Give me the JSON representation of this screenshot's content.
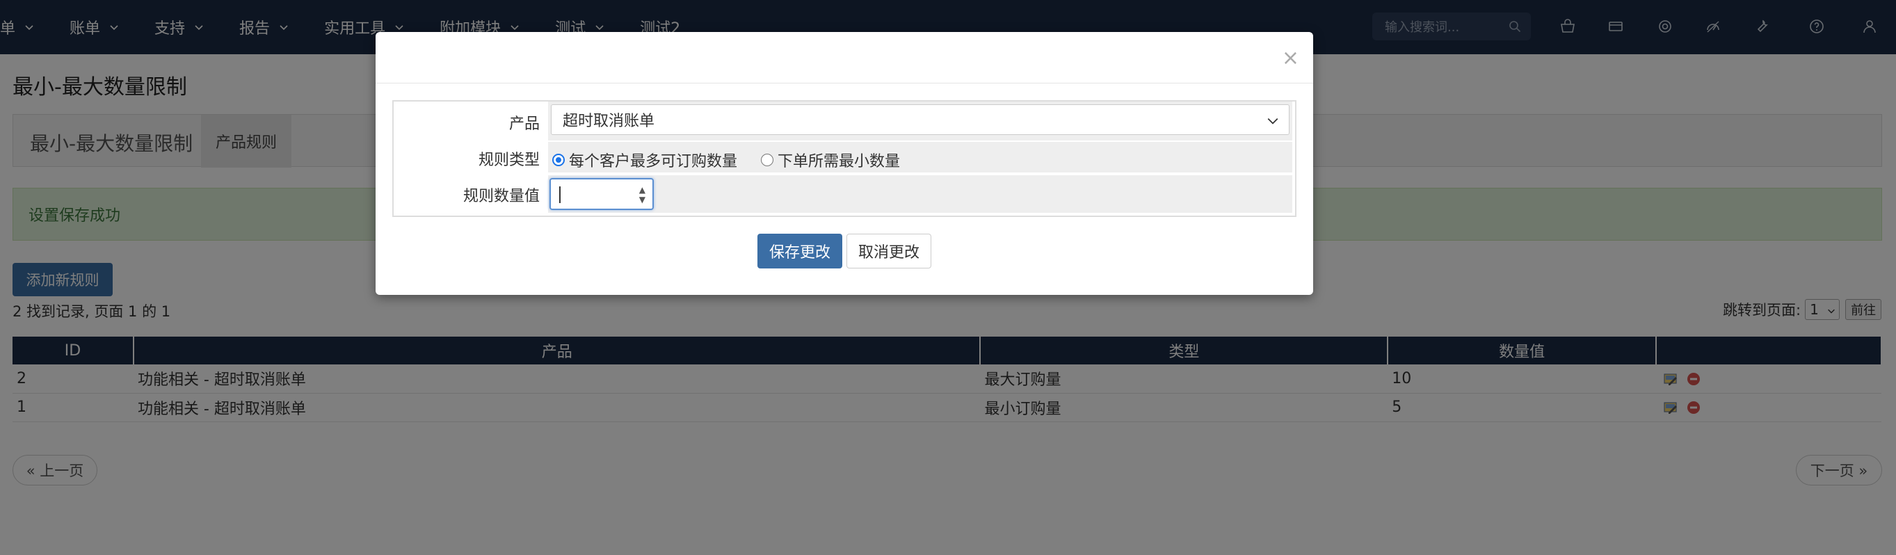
{
  "nav": {
    "items": [
      "单",
      "账单",
      "支持",
      "报告",
      "实用工具",
      "附加模块",
      "测试",
      "测试2"
    ],
    "search_placeholder": "输入搜索词...",
    "icons": [
      "cart-icon",
      "ticket-icon",
      "support-icon",
      "gauge-icon",
      "wrench-icon",
      "help-icon",
      "user-icon"
    ]
  },
  "page": {
    "title": "最小-最大数量限制",
    "tab_main": "最小-最大数量限制",
    "tab_active": "产品规则",
    "alert": "设置保存成功",
    "add_button": "添加新规则",
    "records": "2 找到记录, 页面 1 的 1",
    "jump_label": "跳转到页面:",
    "jump_value": "1",
    "jump_go": "前往",
    "prev": "« 上一页",
    "next": "下一页 »"
  },
  "table": {
    "headers": [
      "ID",
      "产品",
      "类型",
      "数量值",
      ""
    ],
    "rows": [
      {
        "id": "2",
        "product": "功能相关 - 超时取消账单",
        "type": "最大订购量",
        "value": "10"
      },
      {
        "id": "1",
        "product": "功能相关 - 超时取消账单",
        "type": "最小订购量",
        "value": "5"
      }
    ]
  },
  "modal": {
    "close": "×",
    "product_label": "产品",
    "product_value": "超时取消账单",
    "rule_type_label": "规则类型",
    "rule_type_options": [
      "每个客户最多可订购数量",
      "下单所需最小数量"
    ],
    "rule_type_selected": 0,
    "rule_value_label": "规则数量值",
    "rule_value": "",
    "save": "保存更改",
    "cancel": "取消更改"
  }
}
